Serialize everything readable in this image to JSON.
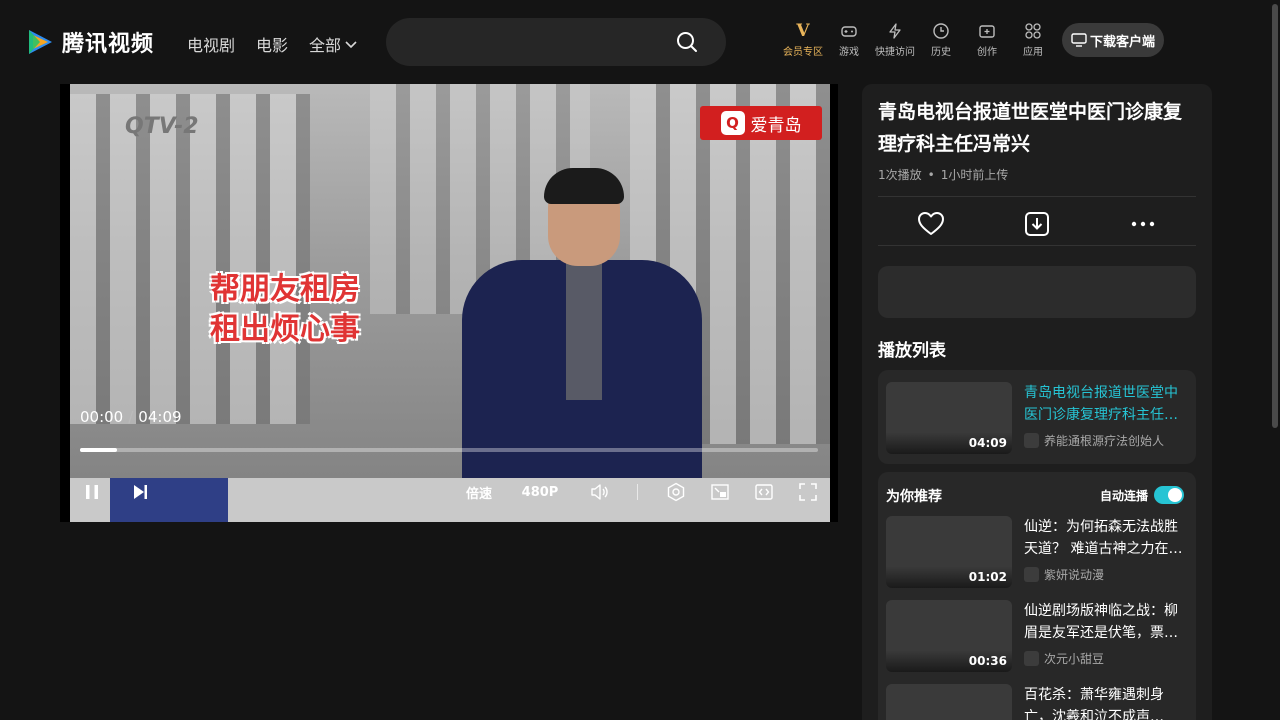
{
  "header": {
    "logo_text": "腾讯视频",
    "nav": [
      {
        "label": "电视剧"
      },
      {
        "label": "电影"
      },
      {
        "label": "全部"
      }
    ],
    "search": {
      "placeholder": ""
    },
    "tools": [
      {
        "label": "会员专区",
        "icon": "vip-icon"
      },
      {
        "label": "游戏",
        "icon": "gamepad-icon"
      },
      {
        "label": "快捷访问",
        "icon": "lightning-icon"
      },
      {
        "label": "历史",
        "icon": "clock-icon"
      },
      {
        "label": "创作",
        "icon": "video-create-icon"
      },
      {
        "label": "应用",
        "icon": "apps-icon"
      }
    ],
    "download_label": "下载客户端",
    "vip_color": "#e8b45a"
  },
  "player": {
    "current_time": "00:00",
    "separator": "/",
    "duration": "04:09",
    "progress": 0.05,
    "speed_label": "倍速",
    "quality_label": "480P",
    "video_overlay": {
      "channel": "QTV-2",
      "brand": "爱青岛",
      "caption_line1": "帮朋友租房",
      "caption_line2": "租出烦心事"
    }
  },
  "side": {
    "title": "青岛电视台报道世医堂中医门诊康复理疗科主任冯常兴",
    "plays": "1次播放",
    "uploaded": "1小时前上传",
    "playlist_heading": "播放列表",
    "playlist": [
      {
        "title": "青岛电视台报道世医堂中医门诊康复理疗科主任冯常兴",
        "author": "养能通根源疗法创始人",
        "duration": "04:09"
      }
    ],
    "recommend_heading": "为你推荐",
    "autoplay_label": "自动连播",
    "autoplay_on": true,
    "recommendations": [
      {
        "title": "仙逆：为何拓森无法战胜天道？  难道古神之力在…",
        "author": "紫妍说动漫",
        "duration": "01:02"
      },
      {
        "title": "仙逆剧场版神临之战：柳眉是友军还是伏笔，票…",
        "author": "次元小甜豆",
        "duration": "00:36"
      },
      {
        "title": "百花杀：萧华雍遇刺身亡，沈羲和泣不成声…",
        "author": "",
        "duration": ""
      }
    ],
    "accent_color": "#26c4d4"
  }
}
